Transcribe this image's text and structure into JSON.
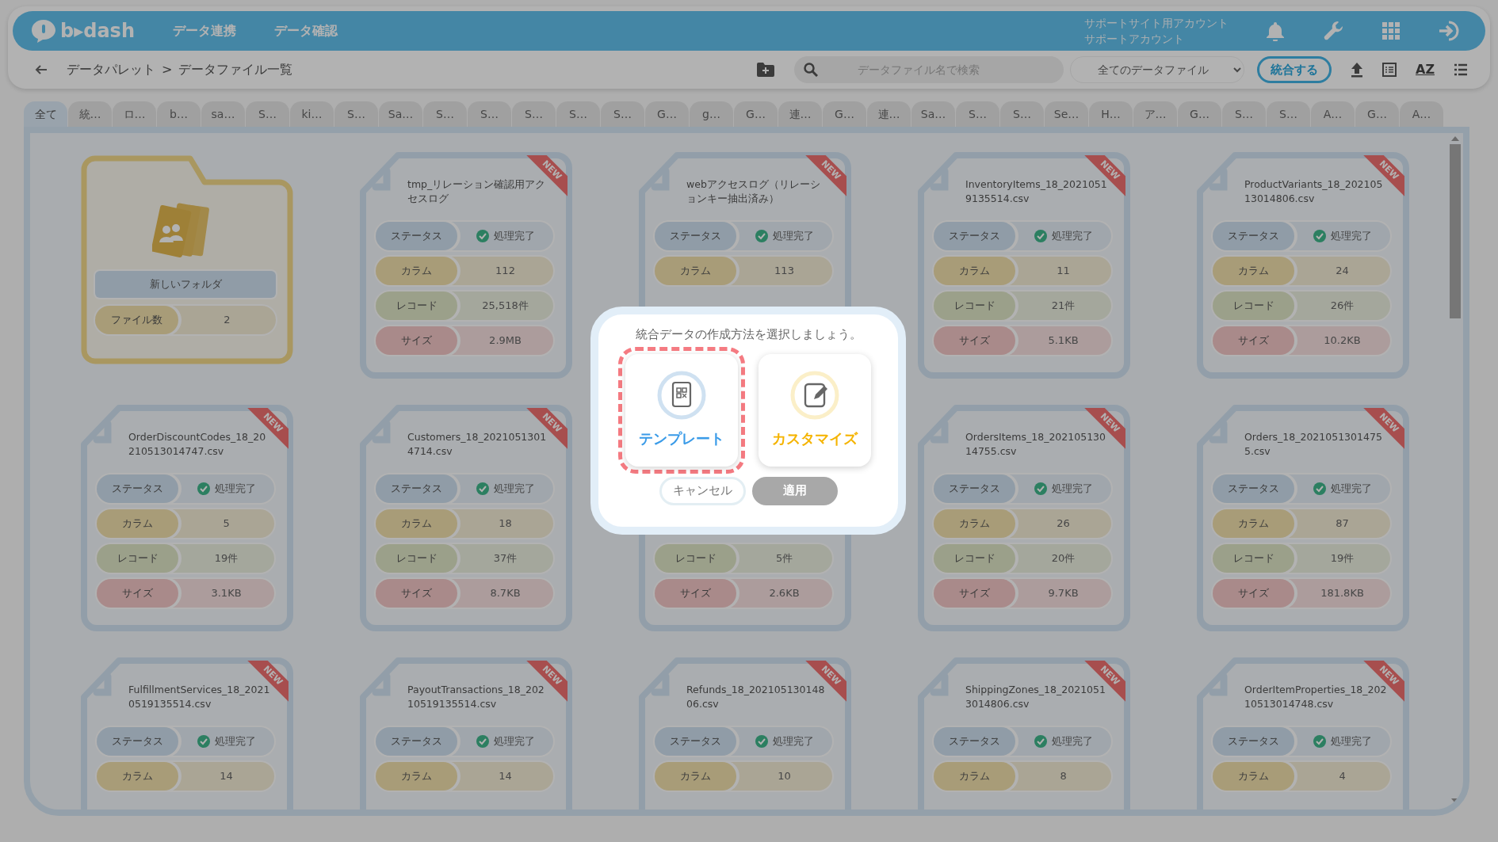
{
  "header": {
    "logo": "b▸dash",
    "nav": [
      "データ連携",
      "データ確認"
    ],
    "account": [
      "サポートサイト用アカウント",
      "サポートアカウント"
    ]
  },
  "toolbar": {
    "breadcrumb": [
      "データパレット",
      "データファイル一覧"
    ],
    "separator": ">",
    "search": {
      "placeholder": "データファイル名で検索"
    },
    "filter": "全てのデータファイル",
    "merge_button": "統合する",
    "sort_label": "AZ"
  },
  "tabs": [
    {
      "label": "全て",
      "selected": true
    },
    {
      "label": "統…",
      "selected": false
    },
    {
      "label": "ロ…",
      "selected": false
    },
    {
      "label": "b…",
      "selected": false
    },
    {
      "label": "sa…",
      "selected": false
    },
    {
      "label": "S…",
      "selected": false
    },
    {
      "label": "ki…",
      "selected": false
    },
    {
      "label": "S…",
      "selected": false
    },
    {
      "label": "Sa…",
      "selected": false
    },
    {
      "label": "S…",
      "selected": false
    },
    {
      "label": "S…",
      "selected": false
    },
    {
      "label": "S…",
      "selected": false
    },
    {
      "label": "S…",
      "selected": false
    },
    {
      "label": "S…",
      "selected": false
    },
    {
      "label": "G…",
      "selected": false
    },
    {
      "label": "g…",
      "selected": false
    },
    {
      "label": "G…",
      "selected": false
    },
    {
      "label": "連…",
      "selected": false
    },
    {
      "label": "G…",
      "selected": false
    },
    {
      "label": "連…",
      "selected": false
    },
    {
      "label": "Sa…",
      "selected": false
    },
    {
      "label": "S…",
      "selected": false
    },
    {
      "label": "S…",
      "selected": false
    },
    {
      "label": "Se…",
      "selected": false
    },
    {
      "label": "H…",
      "selected": false
    },
    {
      "label": "ア…",
      "selected": false
    },
    {
      "label": "G…",
      "selected": false
    },
    {
      "label": "S…",
      "selected": false
    },
    {
      "label": "S…",
      "selected": false
    },
    {
      "label": "A…",
      "selected": false
    },
    {
      "label": "G…",
      "selected": false
    },
    {
      "label": "A…",
      "selected": false
    }
  ],
  "items": [
    {
      "kind": "folder",
      "name": "新しいフォルダ",
      "stats": [
        {
          "kind": "count",
          "label": "ファイル数",
          "value": "2"
        }
      ]
    },
    {
      "kind": "file",
      "name": "tmp_リレーション確認用アクセスログ",
      "badge": "NEW",
      "stats": [
        {
          "kind": "status",
          "label": "ステータス",
          "value": "処理完了"
        },
        {
          "kind": "column",
          "label": "カラム",
          "value": "112"
        },
        {
          "kind": "record",
          "label": "レコード",
          "value": "25,518件"
        },
        {
          "kind": "size",
          "label": "サイズ",
          "value": "2.9MB"
        }
      ]
    },
    {
      "kind": "file",
      "name": "webアクセスログ（リレーションキー抽出済み）",
      "badge": "NEW",
      "stats": [
        {
          "kind": "status",
          "label": "ステータス",
          "value": "処理完了"
        },
        {
          "kind": "column",
          "label": "カラム",
          "value": "113"
        }
      ]
    },
    {
      "kind": "file",
      "name": "InventoryItems_18_20210519135514.csv",
      "badge": "NEW",
      "stats": [
        {
          "kind": "status",
          "label": "ステータス",
          "value": "処理完了"
        },
        {
          "kind": "column",
          "label": "カラム",
          "value": "11"
        },
        {
          "kind": "record",
          "label": "レコード",
          "value": "21件"
        },
        {
          "kind": "size",
          "label": "サイズ",
          "value": "5.1KB"
        }
      ]
    },
    {
      "kind": "file",
      "name": "ProductVariants_18_20210513014806.csv",
      "badge": "NEW",
      "stats": [
        {
          "kind": "status",
          "label": "ステータス",
          "value": "処理完了"
        },
        {
          "kind": "column",
          "label": "カラム",
          "value": "24"
        },
        {
          "kind": "record",
          "label": "レコード",
          "value": "26件"
        },
        {
          "kind": "size",
          "label": "サイズ",
          "value": "10.2KB"
        }
      ]
    },
    {
      "kind": "file",
      "name": "OrderDiscountCodes_18_20210513014747.csv",
      "badge": "NEW",
      "stats": [
        {
          "kind": "status",
          "label": "ステータス",
          "value": "処理完了"
        },
        {
          "kind": "column",
          "label": "カラム",
          "value": "5"
        },
        {
          "kind": "record",
          "label": "レコード",
          "value": "19件"
        },
        {
          "kind": "size",
          "label": "サイズ",
          "value": "3.1KB"
        }
      ]
    },
    {
      "kind": "file",
      "name": "Customers_18_20210513014714.csv",
      "badge": "NEW",
      "stats": [
        {
          "kind": "status",
          "label": "ステータス",
          "value": "処理完了"
        },
        {
          "kind": "column",
          "label": "カラム",
          "value": "18"
        },
        {
          "kind": "record",
          "label": "レコード",
          "value": "37件"
        },
        {
          "kind": "size",
          "label": "サイズ",
          "value": "8.7KB"
        }
      ]
    },
    {
      "kind": "file",
      "stats": [
        {
          "kind": "record",
          "label": "レコード",
          "value": "5件"
        },
        {
          "kind": "size",
          "label": "サイズ",
          "value": "2.6KB"
        }
      ]
    },
    {
      "kind": "file",
      "name": "OrdersItems_18_20210513014755.csv",
      "badge": "NEW",
      "stats": [
        {
          "kind": "status",
          "label": "ステータス",
          "value": "処理完了"
        },
        {
          "kind": "column",
          "label": "カラム",
          "value": "26"
        },
        {
          "kind": "record",
          "label": "レコード",
          "value": "20件"
        },
        {
          "kind": "size",
          "label": "サイズ",
          "value": "9.7KB"
        }
      ]
    },
    {
      "kind": "file",
      "name": "Orders_18_20210513014755.csv",
      "badge": "NEW",
      "stats": [
        {
          "kind": "status",
          "label": "ステータス",
          "value": "処理完了"
        },
        {
          "kind": "column",
          "label": "カラム",
          "value": "87"
        },
        {
          "kind": "record",
          "label": "レコード",
          "value": "19件"
        },
        {
          "kind": "size",
          "label": "サイズ",
          "value": "181.8KB"
        }
      ]
    },
    {
      "kind": "file",
      "name": "FulfillmentServices_18_20210519135514.csv",
      "badge": "NEW",
      "stats": [
        {
          "kind": "status",
          "label": "ステータス",
          "value": "処理完了"
        },
        {
          "kind": "column",
          "label": "カラム",
          "value": "14"
        }
      ]
    },
    {
      "kind": "file",
      "name": "PayoutTransactions_18_20210519135514.csv",
      "badge": "NEW",
      "stats": [
        {
          "kind": "status",
          "label": "ステータス",
          "value": "処理完了"
        },
        {
          "kind": "column",
          "label": "カラム",
          "value": "14"
        }
      ]
    },
    {
      "kind": "file",
      "name": "Refunds_18_20210513014806.csv",
      "badge": "NEW",
      "stats": [
        {
          "kind": "status",
          "label": "ステータス",
          "value": "処理完了"
        },
        {
          "kind": "column",
          "label": "カラム",
          "value": "10"
        }
      ]
    },
    {
      "kind": "file",
      "name": "ShippingZones_18_20210513014806.csv",
      "badge": "NEW",
      "stats": [
        {
          "kind": "status",
          "label": "ステータス",
          "value": "処理完了"
        },
        {
          "kind": "column",
          "label": "カラム",
          "value": "8"
        }
      ]
    },
    {
      "kind": "file",
      "name": "OrderItemProperties_18_20210513014748.csv",
      "badge": "NEW",
      "stats": [
        {
          "kind": "status",
          "label": "ステータス",
          "value": "処理完了"
        },
        {
          "kind": "column",
          "label": "カラム",
          "value": "4"
        }
      ]
    }
  ],
  "modal": {
    "prompt": "統合データの作成方法を選択しましょう。",
    "options": [
      {
        "kind": "template",
        "label": "テンプレート",
        "selected": true
      },
      {
        "kind": "customize",
        "label": "カスタマイズ",
        "selected": false
      }
    ],
    "buttons": [
      {
        "label": "キャンセル",
        "disabled": false
      },
      {
        "label": "適用",
        "disabled": true
      }
    ]
  }
}
